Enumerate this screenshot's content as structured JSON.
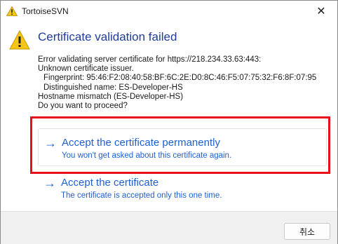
{
  "window": {
    "title": "TortoiseSVN",
    "close_glyph": "✕"
  },
  "dialog": {
    "heading": "Certificate validation failed",
    "lines": [
      "Error validating server certificate for https://218.234.33.63:443:",
      "Unknown certificate issuer.",
      "Fingerprint: 95:46:F2:08:40:58:BF:6C:2E:D0:8C:46:F5:07:75:32:F6:8F:07:95",
      "Distinguished name: ES-Developer-HS",
      "Hostname mismatch (ES-Developer-HS)",
      "Do you want to proceed?"
    ]
  },
  "commands": [
    {
      "arrow": "→",
      "title": "Accept the certificate permanently",
      "description": "You won't get asked about this certificate again."
    },
    {
      "arrow": "→",
      "title": "Accept the certificate",
      "description": "The certificate is accepted only this one time."
    }
  ],
  "footer": {
    "cancel_label": "취소"
  },
  "colors": {
    "heading": "#1f3d99",
    "link": "#1f5fd1",
    "highlight": "#e8101a",
    "warning": "#f5c518"
  },
  "icons": {
    "title": "warning-icon",
    "main": "warning-icon",
    "command": "arrow-right-icon"
  }
}
